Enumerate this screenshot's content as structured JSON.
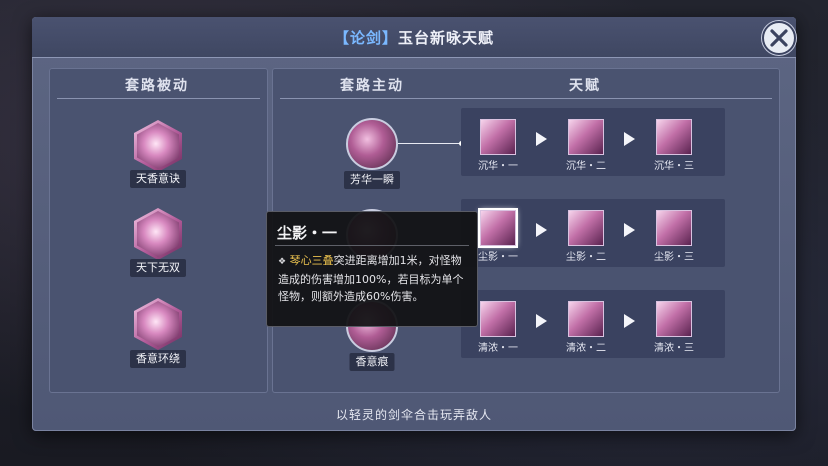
{
  "window": {
    "title_tag": "【论剑】",
    "title": "玉台新咏天赋"
  },
  "left_panel": {
    "header": "套路被动",
    "skills": [
      {
        "label": "天香意诀",
        "icon": "lotus-sword-icon"
      },
      {
        "label": "天下无双",
        "icon": "crescent-swirl-icon"
      },
      {
        "label": "香意环绕",
        "icon": "flower-bloom-icon"
      }
    ]
  },
  "right_panel": {
    "header_active": "套路主动",
    "header_talent": "天赋",
    "rows": [
      {
        "skill": "芳华一瞬",
        "talents": [
          "沉华・一",
          "沉华・二",
          "沉华・三"
        ]
      },
      {
        "skill": "",
        "talents": [
          "尘影・一",
          "尘影・二",
          "尘影・三"
        ]
      },
      {
        "skill": "香意痕",
        "talents": [
          "清浓・一",
          "清浓・二",
          "清浓・三"
        ]
      }
    ]
  },
  "tooltip": {
    "title": "尘影・一",
    "highlight": "琴心三叠",
    "text": "突进距离增加1米，对怪物造成的伤害增加100%，若目标为单个怪物，则额外造成60%伤害。"
  },
  "footer": "以轻灵的剑伞合击玩弄敌人",
  "colors": {
    "accent": "#7ab8ff",
    "highlight": "#e9c04e",
    "panel": "#4a5370"
  }
}
